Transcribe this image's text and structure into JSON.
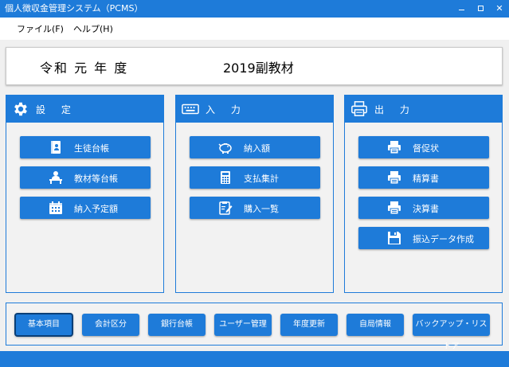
{
  "window": {
    "title": "個人徴収金管理システム（PCMS）",
    "min_label": "",
    "max_label": "",
    "close_label": "✕"
  },
  "menu": {
    "file": "ファイル(F)",
    "help": "ヘルプ(H)"
  },
  "header": {
    "era": "令和 元 年 度",
    "name": "2019副教材"
  },
  "panels": {
    "settings": {
      "title": "設 定",
      "icon": "gear-icon",
      "buttons": [
        {
          "label": "生徒台帳",
          "icon": "student-book-icon"
        },
        {
          "label": "教材等台帳",
          "icon": "teacher-desk-icon"
        },
        {
          "label": "納入予定額",
          "icon": "calendar-icon"
        }
      ]
    },
    "input": {
      "title": "入 力",
      "icon": "keyboard-icon",
      "buttons": [
        {
          "label": "納入額",
          "icon": "piggy-bank-icon"
        },
        {
          "label": "支払集計",
          "icon": "calculator-icon"
        },
        {
          "label": "購入一覧",
          "icon": "clipboard-edit-icon"
        }
      ]
    },
    "output": {
      "title": "出 力",
      "icon": "printer-icon",
      "buttons": [
        {
          "label": "督促状",
          "icon": "printer-icon"
        },
        {
          "label": "精算書",
          "icon": "printer-icon"
        },
        {
          "label": "決算書",
          "icon": "printer-icon"
        },
        {
          "label": "振込データ作成",
          "icon": "floppy-disk-icon"
        }
      ]
    }
  },
  "bottom": {
    "buttons": [
      {
        "label": "基本項目",
        "selected": true
      },
      {
        "label": "会計区分"
      },
      {
        "label": "銀行台帳"
      },
      {
        "label": "ユーザー管理"
      },
      {
        "label": "年度更新"
      },
      {
        "label": "自局情報"
      },
      {
        "label": "バックアップ・リストア"
      }
    ]
  },
  "colors": {
    "accent": "#1e7bd9",
    "background": "#f0f0f0",
    "panel_bg": "#f2f2f2"
  }
}
